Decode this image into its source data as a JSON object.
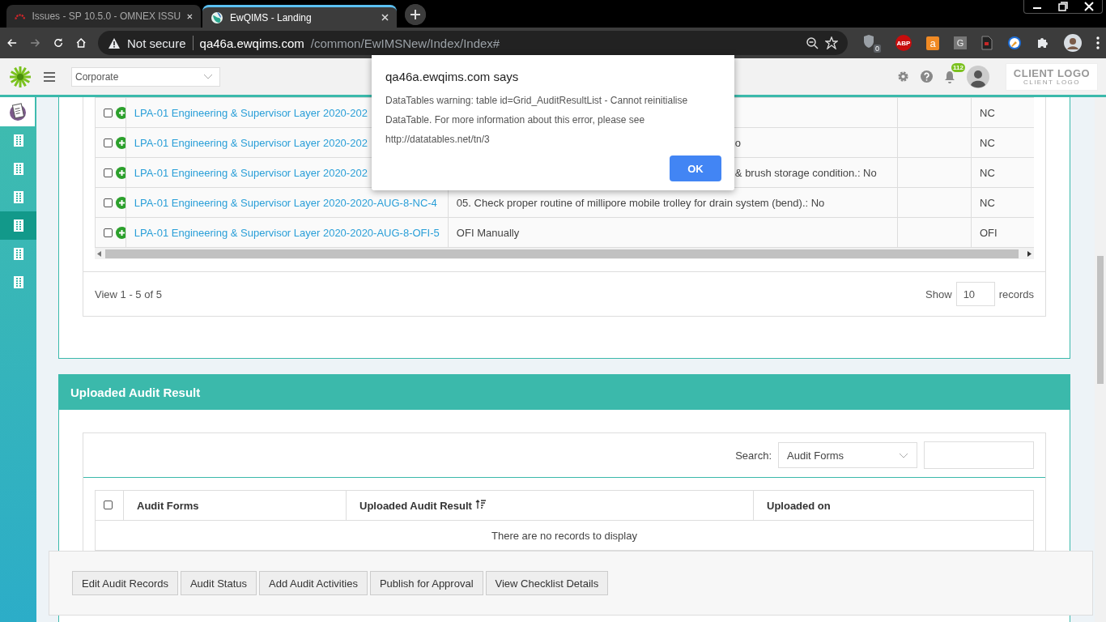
{
  "browser": {
    "tabs": [
      {
        "title": "Issues - SP 10.5.0 - OMNEX ISSU",
        "selected": false
      },
      {
        "title": "EwQIMS - Landing",
        "selected": true
      }
    ],
    "address": {
      "security": "Not secure",
      "host": "qa46a.ewqims.com",
      "path": "/common/EwIMSNew/Index/Index#"
    },
    "extensions": [
      {
        "kind": "shield",
        "label": "0"
      },
      {
        "kind": "abp",
        "label": "ABP"
      },
      {
        "kind": "bag",
        "label": "a"
      },
      {
        "kind": "g",
        "label": "G"
      },
      {
        "kind": "doc"
      },
      {
        "kind": "brush"
      },
      {
        "kind": "puzzle"
      }
    ]
  },
  "header": {
    "unit": "Corporate",
    "notifications": "112",
    "logo": "CLIENT LOGO",
    "logo_sub": "CLIENT LOGO"
  },
  "sidebar": {
    "items": [
      {
        "kind": "clipboard",
        "selected": false
      },
      {
        "kind": "building",
        "selected": false
      },
      {
        "kind": "building",
        "selected": false
      },
      {
        "kind": "building",
        "selected": false
      },
      {
        "kind": "building",
        "selected": true
      },
      {
        "kind": "building",
        "selected": false
      },
      {
        "kind": "building",
        "selected": false
      }
    ]
  },
  "results": {
    "rows": [
      {
        "checked": false,
        "link": "LPA-01 Engineering & Supervisor Layer 2020-202",
        "finding": {
          "kind": "covered"
        },
        "type": "NC"
      },
      {
        "checked": false,
        "link": "LPA-01 Engineering & Supervisor Layer 2020-202",
        "finding": {
          "kind": "partial",
          "text": "o"
        },
        "type": "NC"
      },
      {
        "checked": false,
        "link": "LPA-01 Engineering & Supervisor Layer 2020-202",
        "finding": {
          "kind": "partial",
          "text": "& brush storage condition.: No"
        },
        "type": "NC"
      },
      {
        "checked": false,
        "link": "LPA-01 Engineering & Supervisor Layer 2020-2020-AUG-8-NC-4",
        "finding": {
          "kind": "full",
          "text": "05. Check proper routine of millipore mobile trolley for drain system (bend).: No"
        },
        "type": "NC"
      },
      {
        "checked": false,
        "link": "LPA-01 Engineering & Supervisor Layer 2020-2020-AUG-8-OFI-5",
        "finding": {
          "kind": "full",
          "text": "OFI Manually"
        },
        "type": "OFI"
      }
    ],
    "info": "View 1 - 5 of 5",
    "show_label": "Show",
    "page_size": "10",
    "records_label": "records"
  },
  "uploaded": {
    "title": "Uploaded Audit Result",
    "search_label": "Search:",
    "select_all": {
      "checked": false
    },
    "search_field": "Audit Forms",
    "columns": [
      "Audit Forms",
      "Uploaded Audit Result",
      "Uploaded on"
    ],
    "empty": "There are no records to display"
  },
  "actions": [
    "Edit Audit Records",
    "Audit Status",
    "Add Audit Activities",
    "Publish for Approval",
    "View Checklist Details"
  ],
  "dialog": {
    "title": "qa46a.ewqims.com says",
    "message": "DataTables warning: table id=Grid_AuditResultList - Cannot reinitialise DataTable. For more information about this error, please see http://datatables.net/tn/3",
    "button": "OK"
  }
}
